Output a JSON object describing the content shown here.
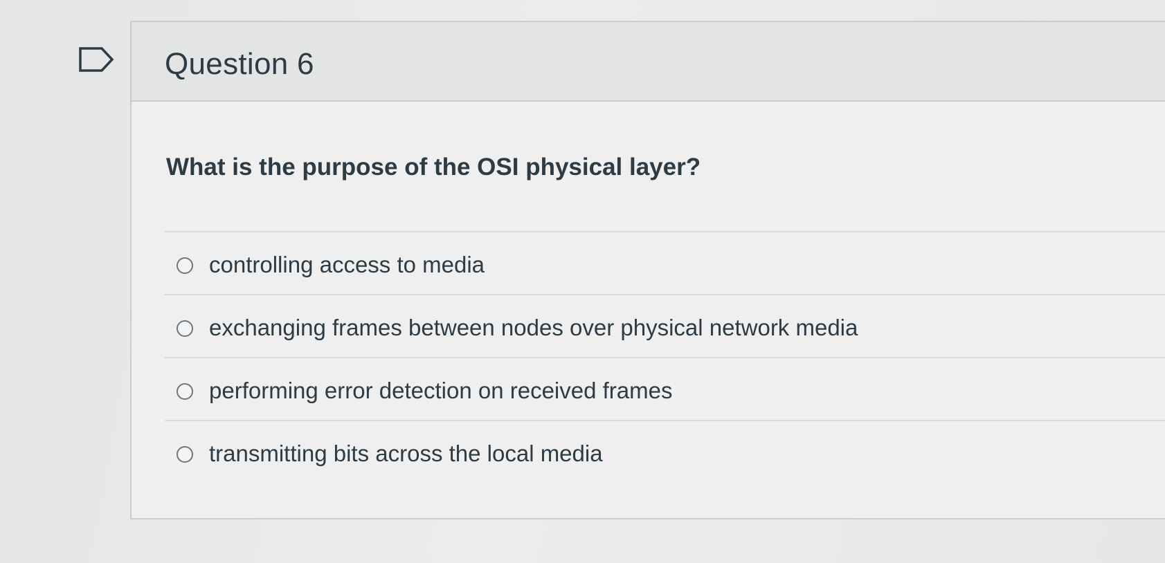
{
  "question": {
    "title": "Question 6",
    "text": "What is the purpose of the OSI physical layer?",
    "flag_icon": "flag-outline-icon"
  },
  "answers": [
    {
      "label": "controlling access to media",
      "selected": false
    },
    {
      "label": "exchanging frames between nodes over physical network media",
      "selected": false
    },
    {
      "label": "performing error detection on received frames",
      "selected": false
    },
    {
      "label": "transmitting bits across the local media",
      "selected": false
    }
  ],
  "colors": {
    "text": "#2d3b45",
    "border": "#c7cdd1",
    "background": "#e7e8e8"
  }
}
